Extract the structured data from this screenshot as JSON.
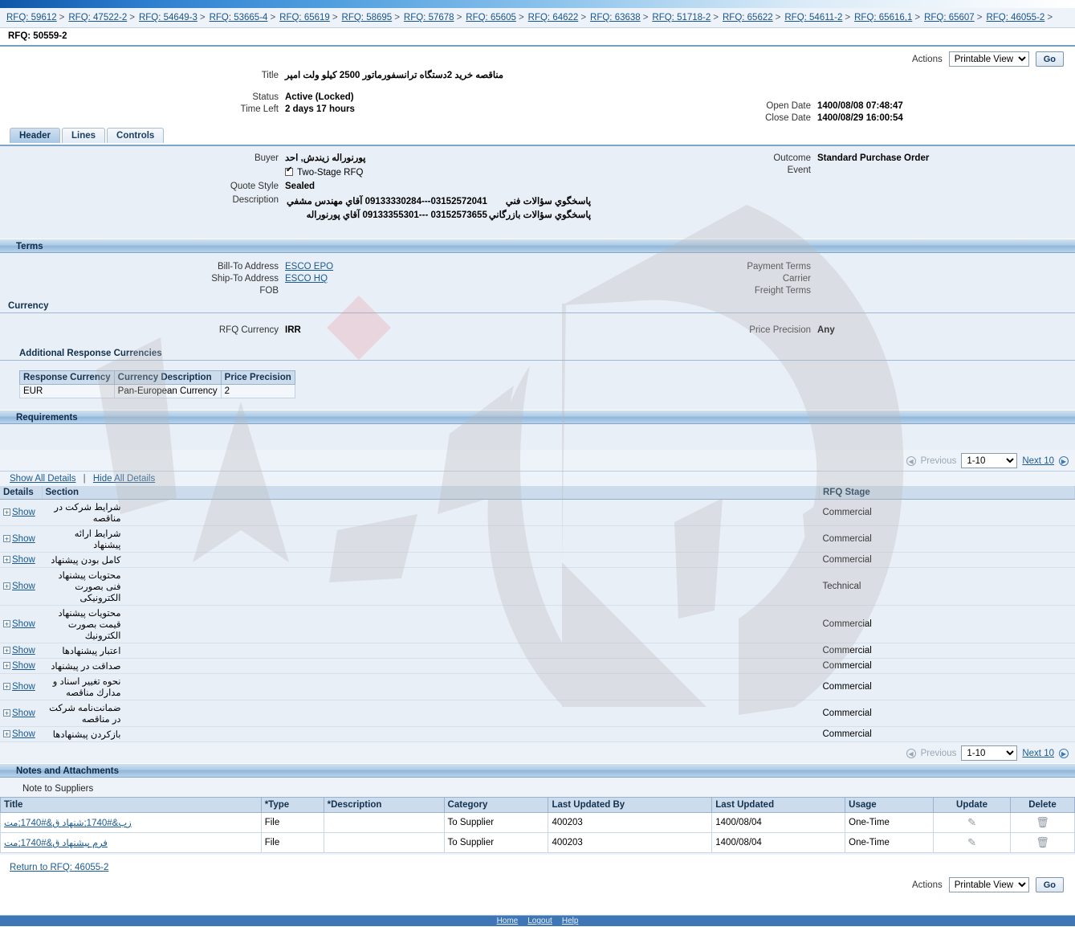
{
  "breadcrumbs": [
    "RFQ: 59612",
    "RFQ: 47522-2",
    "RFQ: 54649-3",
    "RFQ: 53665-4",
    "RFQ: 65619",
    "RFQ: 58695",
    "RFQ: 57678",
    "RFQ: 65605",
    "RFQ: 64622",
    "RFQ: 63638",
    "RFQ: 51718-2",
    "RFQ: 65622",
    "RFQ: 54611-2",
    "RFQ: 65616,1",
    "RFQ: 65607",
    "RFQ: 46055-2"
  ],
  "breadcrumb_separator": ">",
  "page_title": "RFQ: 50559-2",
  "actions": {
    "label": "Actions",
    "selected": "Printable View",
    "options": [
      "Printable View"
    ],
    "go_label": "Go"
  },
  "summary": {
    "title_label": "Title",
    "title_value": "مناقصه خرید 2دستگاه ترانسفورماتور 2500 کیلو ولت امپر",
    "status_label": "Status",
    "status_value": "Active (Locked)",
    "time_left_label": "Time Left",
    "time_left_value": "2 days 17 hours",
    "open_date_label": "Open Date",
    "open_date_value": "1400/08/08 07:48:47",
    "close_date_label": "Close Date",
    "close_date_value": "1400/08/29 16:00:54"
  },
  "tabs": [
    {
      "label": "Header",
      "selected": true
    },
    {
      "label": "Lines",
      "selected": false
    },
    {
      "label": "Controls",
      "selected": false
    }
  ],
  "header_region": {
    "buyer_label": "Buyer",
    "buyer_value": "پورنوراله زیندش, احد",
    "two_stage_label": "Two-Stage RFQ",
    "two_stage_checked": true,
    "quote_style_label": "Quote Style",
    "quote_style_value": "Sealed",
    "description_label": "Description",
    "description_rows": [
      {
        "phone": "03152572041---09133330284",
        "name": "آقاي مهندس مشفي",
        "role": "پاسخگوي سؤالات فني"
      },
      {
        "phone": "03152573655 ---09133355301",
        "name": "آقاي پورنوراله",
        "role": "پاسخگوي سؤالات بازرگاني"
      }
    ],
    "outcome_label": "Outcome",
    "outcome_value": "Standard Purchase Order",
    "event_label": "Event",
    "event_value": ""
  },
  "terms": {
    "section_title": "Terms",
    "bill_to_label": "Bill-To Address",
    "bill_to_value": "ESCO EPO",
    "ship_to_label": "Ship-To Address",
    "ship_to_value": "ESCO HQ",
    "fob_label": "FOB",
    "fob_value": "",
    "payment_terms_label": "Payment Terms",
    "payment_terms_value": "",
    "carrier_label": "Carrier",
    "carrier_value": "",
    "freight_terms_label": "Freight Terms",
    "freight_terms_value": ""
  },
  "currency": {
    "section_title": "Currency",
    "rfq_currency_label": "RFQ Currency",
    "rfq_currency_value": "IRR",
    "price_precision_label": "Price Precision",
    "price_precision_value": "Any",
    "additional_title": "Additional Response Currencies",
    "columns": [
      "Response Currency",
      "Currency Description",
      "Price Precision"
    ],
    "rows": [
      [
        "EUR",
        "Pan-European Currency",
        "2"
      ]
    ]
  },
  "requirements": {
    "section_title": "Requirements",
    "show_all": "Show All Details",
    "hide_all": "Hide All Details",
    "pagination": {
      "previous": "Previous",
      "range": "1-10",
      "options": [
        "1-10"
      ],
      "next": "Next 10"
    },
    "columns": [
      "Details",
      "Section",
      "RFQ Stage"
    ],
    "show_label": "Show",
    "rows": [
      {
        "section": "شرایط شرکت در مناقصه",
        "stage": "Commercial"
      },
      {
        "section": "شرایط ارائه پیشنهاد",
        "stage": "Commercial"
      },
      {
        "section": "کامل بودن پیشنهاد",
        "stage": "Commercial"
      },
      {
        "section": "محتویات پیشنهاد فنی بصورت الکترونیکی",
        "stage": "Technical"
      },
      {
        "section": "محتویات پیشنهاد قیمت بصورت الکترونیك",
        "stage": "Commercial"
      },
      {
        "section": "اعتبار پیشنهادها",
        "stage": "Commercial"
      },
      {
        "section": "صداقت در پیشنهاد",
        "stage": "Commercial"
      },
      {
        "section": "نحوه تغییر اسناد و مدارك مناقصه",
        "stage": "Commercial"
      },
      {
        "section": "ضمانت‌نامه شرکت در مناقصه",
        "stage": "Commercial"
      },
      {
        "section": "بازکردن پیشنهادها",
        "stage": "Commercial"
      }
    ]
  },
  "notes": {
    "section_title": "Notes and Attachments",
    "note_to_suppliers_label": "Note to Suppliers",
    "columns": [
      "Title",
      "*Type",
      "*Description",
      "Category",
      "Last Updated By",
      "Last Updated",
      "Usage",
      "Update",
      "Delete"
    ],
    "rows": [
      {
        "title": "زب&#1740;شنهاد ق&#1740;مت",
        "type": "File",
        "description": "",
        "category": "To Supplier",
        "last_updated_by": "400203",
        "last_updated": "1400/08/04",
        "usage": "One-Time",
        "update_icon": "pencil-icon",
        "delete_icon": "trash-icon"
      },
      {
        "title": "فرم پیشنهاد ق&#1740;مت",
        "type": "File",
        "description": "",
        "category": "To Supplier",
        "last_updated_by": "400203",
        "last_updated": "1400/08/04",
        "usage": "One-Time",
        "update_icon": "pencil-icon",
        "delete_icon": "trash-icon"
      }
    ]
  },
  "footer": {
    "return_link": "Return to RFQ: 46055-2",
    "actions_label": "Actions",
    "actions_selected": "Printable View",
    "go_label": "Go",
    "links": [
      "Home",
      "Logout",
      "Help"
    ]
  },
  "colors": {
    "accent": "#3f76b5",
    "section_bar": "#8fb6db",
    "link": "#1a5a93",
    "region_bg": "#e9eff7"
  }
}
